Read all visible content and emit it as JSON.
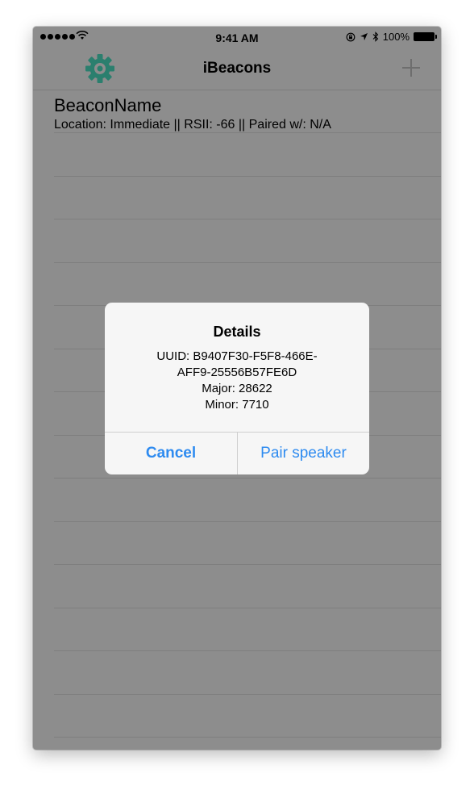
{
  "status_bar": {
    "time": "9:41 AM",
    "battery_percent": "100%",
    "signal_dots": 5,
    "icons": [
      "wifi-icon",
      "orientation-lock-icon",
      "location-arrow-icon",
      "bluetooth-icon",
      "battery-icon"
    ]
  },
  "nav": {
    "title": "iBeacons",
    "left_icon": "gear-icon",
    "right_icon": "plus-icon"
  },
  "beacon_list": [
    {
      "name": "BeaconName",
      "details": "Location: Immediate || RSII: -66 || Paired w/: N/A"
    }
  ],
  "alert": {
    "title": "Details",
    "message_lines": [
      "UUID: B9407F30-F5F8-466E-",
      "AFF9-25556B57FE6D",
      "Major: 28622",
      "Minor: 7710"
    ],
    "cancel_label": "Cancel",
    "confirm_label": "Pair speaker"
  },
  "colors": {
    "accent": "#2e8bf0",
    "gear": "#2b7f6e",
    "dimmed_background": "#8d8d8d"
  }
}
